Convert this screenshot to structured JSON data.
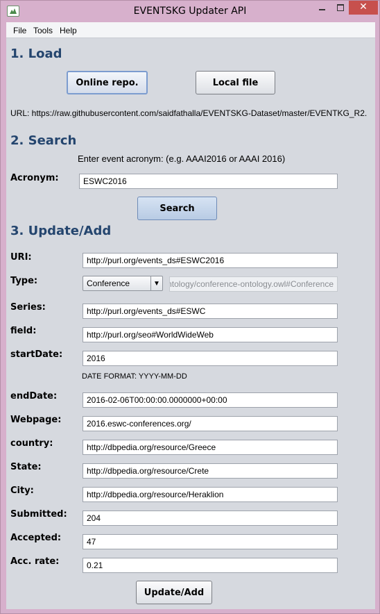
{
  "window": {
    "title": "EVENTSKG Updater API"
  },
  "menu": {
    "file": "File",
    "tools": "Tools",
    "help": "Help"
  },
  "load": {
    "heading": "1. Load",
    "online_button": "Online repo.",
    "local_button": "Local file",
    "url_text": "URL: https://raw.githubusercontent.com/saidfathalla/EVENTSKG-Dataset/master/EVENTKG_R2."
  },
  "search": {
    "heading": "2. Search",
    "hint": "Enter event acronym: (e.g. AAAI2016 or AAAI 2016)",
    "acronym_label": "Acronym:",
    "acronym_value": "ESWC2016",
    "search_button": "Search"
  },
  "update": {
    "heading": "3. Update/Add",
    "uri_label": "URI:",
    "uri_value": "http://purl.org/events_ds#ESWC2016",
    "type_label": "Type:",
    "type_selected": "Conference",
    "type_uri": "http://purl.org/seo/ontology/conference-ontology.owl#Conference",
    "series_label": "Series:",
    "series_value": "http://purl.org/events_ds#ESWC",
    "field_label": "field:",
    "field_value": "http://purl.org/seo#WorldWideWeb",
    "startdate_label": "startDate:",
    "startdate_value": "2016",
    "date_format": "DATE FORMAT: YYYY-MM-DD",
    "enddate_label": "endDate:",
    "enddate_value": "2016-02-06T00:00:00.0000000+00:00",
    "webpage_label": "Webpage:",
    "webpage_value": "2016.eswc-conferences.org/",
    "country_label": "country:",
    "country_value": "http://dbpedia.org/resource/Greece",
    "state_label": "State:",
    "state_value": "http://dbpedia.org/resource/Crete",
    "city_label": "City:",
    "city_value": "http://dbpedia.org/resource/Heraklion",
    "submitted_label": "Submitted:",
    "submitted_value": "204",
    "accepted_label": "Accepted:",
    "accepted_value": "47",
    "accrate_label": "Acc. rate:",
    "accrate_value": "0.21",
    "update_button": "Update/Add"
  },
  "icons": {
    "app": "app-logo-icon",
    "dropdown": "chevron-down-icon",
    "minimize": "minimize-icon",
    "maximize": "maximize-icon",
    "close": "close-icon"
  },
  "colors": {
    "frame": "#d7b0cc",
    "panel": "#d6d9df",
    "heading": "#24456e",
    "close": "#c7504d"
  }
}
